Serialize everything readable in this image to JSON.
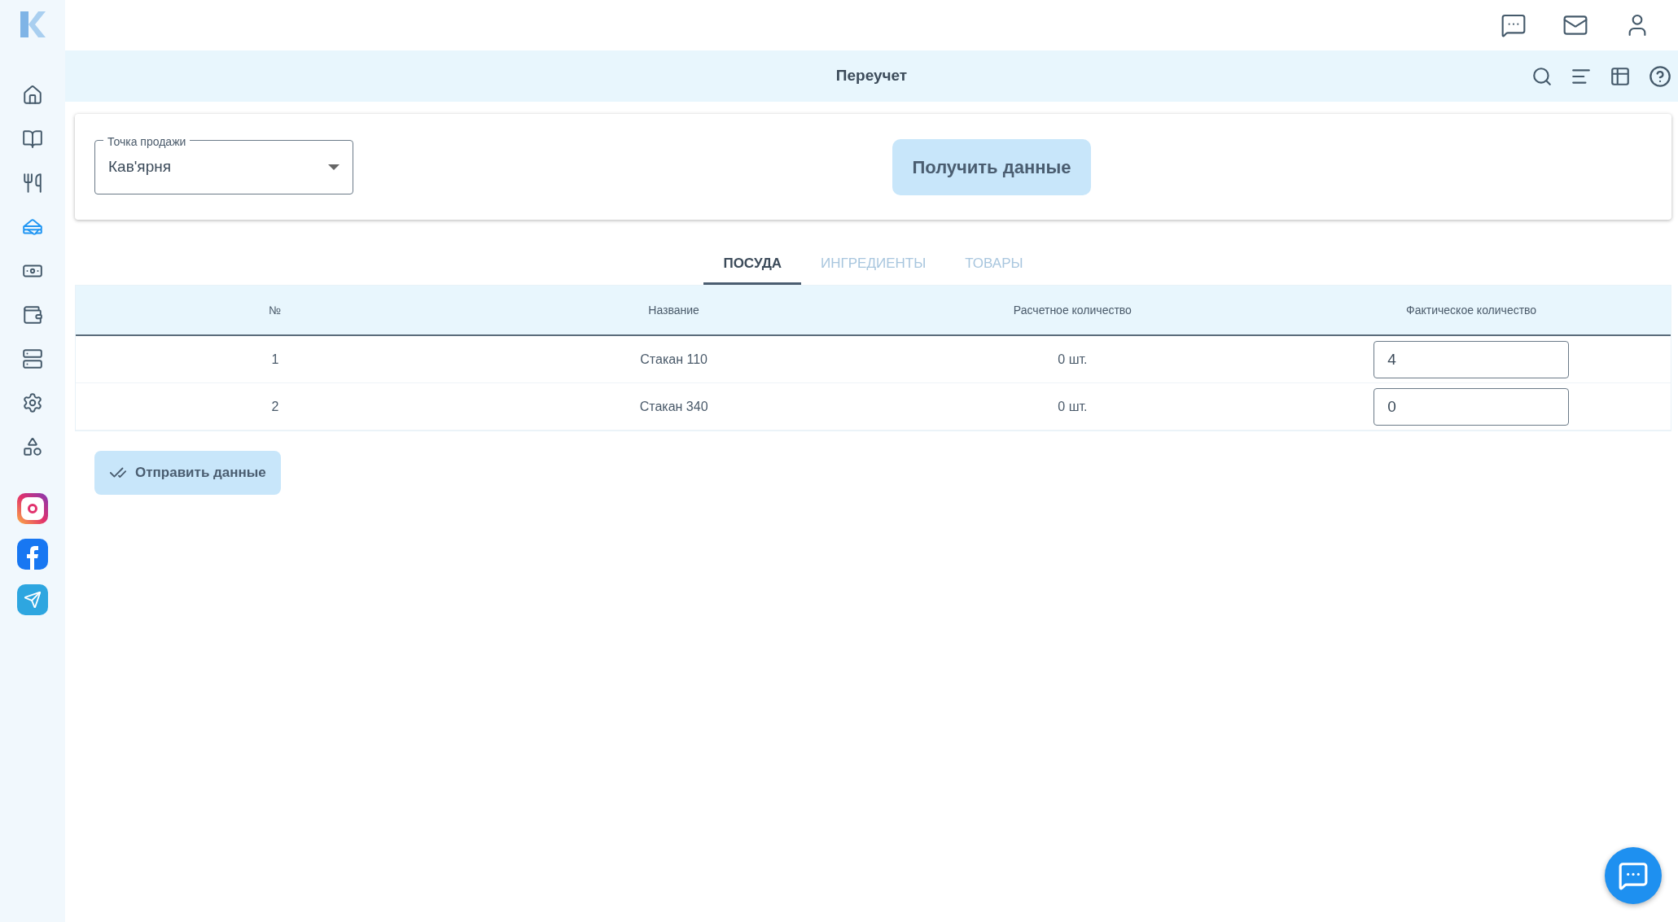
{
  "header": {
    "title": "Переучет"
  },
  "sidebar": {
    "items": [
      {
        "selected": false
      },
      {
        "selected": false
      },
      {
        "selected": false
      },
      {
        "selected": true
      },
      {
        "selected": false
      },
      {
        "selected": false
      },
      {
        "selected": false
      },
      {
        "selected": false
      },
      {
        "selected": false
      }
    ]
  },
  "filter": {
    "label": "Точка продажи",
    "value": "Кав'ярня",
    "button": "Получить данные"
  },
  "tabs": [
    {
      "label": "ПОСУДА",
      "selected": true
    },
    {
      "label": "ИНГРЕДИЕНТЫ",
      "selected": false
    },
    {
      "label": "ТОВАРЫ",
      "selected": false
    }
  ],
  "table": {
    "columns": [
      "№",
      "Название",
      "Расчетное количество",
      "Фактическое количество"
    ],
    "rows": [
      {
        "number": "1",
        "name": "Стакан 110",
        "calculated": "0 шт.",
        "actual": "4"
      },
      {
        "number": "2",
        "name": "Стакан 340",
        "calculated": "0 шт.",
        "actual": "0"
      }
    ]
  },
  "submit_button": "Отправить данные"
}
